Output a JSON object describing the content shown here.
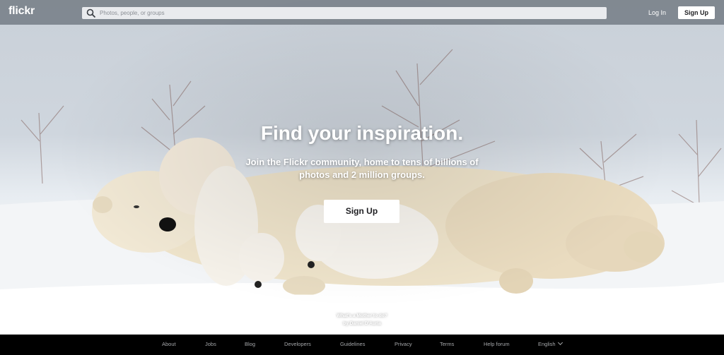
{
  "brand": {
    "logo": "flickr"
  },
  "search": {
    "placeholder": "Photos, people, or groups"
  },
  "header": {
    "login": "Log In",
    "signup": "Sign Up"
  },
  "hero": {
    "headline": "Find your inspiration.",
    "subline": "Join the Flickr community, home to tens of billions of photos and 2 million groups.",
    "cta": "Sign Up",
    "photo_title": "What's a Mother to do?",
    "photo_credit": "by Daniel D'Auria"
  },
  "footer": {
    "links": [
      "About",
      "Jobs",
      "Blog",
      "Developers",
      "Guidelines",
      "Privacy",
      "Terms",
      "Help forum"
    ],
    "language": "English"
  },
  "icons": {
    "search": "search-icon",
    "language_dropdown": "chevron-down-icon"
  },
  "colors": {
    "topbar": "#46505a",
    "footer": "#000000",
    "button_bg": "#ffffff",
    "button_text": "#212124"
  }
}
